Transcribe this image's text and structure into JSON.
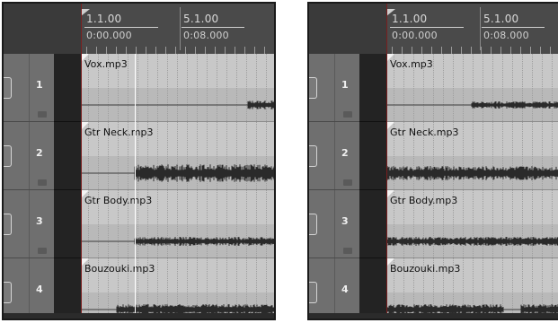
{
  "panels": [
    {
      "id": "left",
      "ruler": {
        "bar1": "1.1.00",
        "time1": "0:00.000",
        "bar2": "5.1.00",
        "time2": "0:08.000"
      },
      "tracks": [
        {
          "number": "1",
          "item": "Vox.mp3"
        },
        {
          "number": "2",
          "item": "Gtr Neck.mp3"
        },
        {
          "number": "3",
          "item": "Gtr Body.mp3"
        },
        {
          "number": "4",
          "item": "Bouzouki.mp3"
        }
      ]
    },
    {
      "id": "right",
      "ruler": {
        "bar1": "1.1.00",
        "time1": "0:00.000",
        "bar2": "5.1.00",
        "time2": "0:08.000"
      },
      "tracks": [
        {
          "number": "1",
          "item": "Vox.mp3"
        },
        {
          "number": "2",
          "item": "Gtr Neck.mp3"
        },
        {
          "number": "3",
          "item": "Gtr Body.mp3"
        },
        {
          "number": "4",
          "item": "Bouzouki.mp3"
        }
      ]
    }
  ],
  "colors": {
    "tcp": "#6f6f6f",
    "lane": "#c6c6c6",
    "waveform": "#2a2a2a",
    "ruler": "#4a4a4a",
    "edit_cursor": "#ffffff"
  }
}
